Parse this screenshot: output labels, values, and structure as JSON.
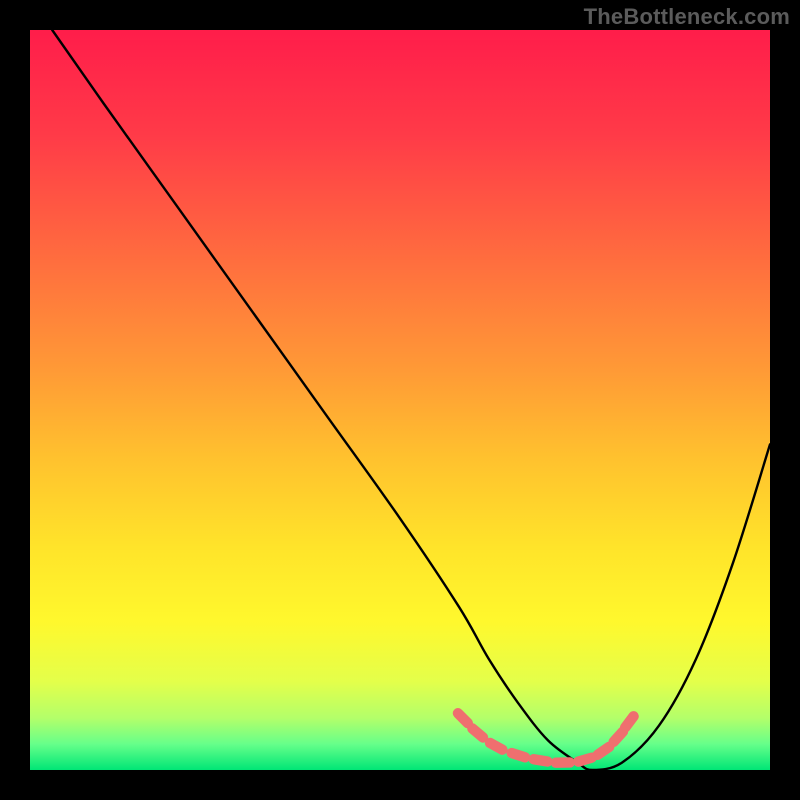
{
  "watermark": "TheBottleneck.com",
  "colors": {
    "gradient_stops": [
      {
        "offset": 0.0,
        "color": "#ff1d4a"
      },
      {
        "offset": 0.14,
        "color": "#ff3a48"
      },
      {
        "offset": 0.3,
        "color": "#ff6a3f"
      },
      {
        "offset": 0.46,
        "color": "#ff9a36"
      },
      {
        "offset": 0.58,
        "color": "#ffc22e"
      },
      {
        "offset": 0.7,
        "color": "#ffe42a"
      },
      {
        "offset": 0.8,
        "color": "#fff82d"
      },
      {
        "offset": 0.88,
        "color": "#e4ff4a"
      },
      {
        "offset": 0.93,
        "color": "#b3ff6a"
      },
      {
        "offset": 0.965,
        "color": "#66ff8a"
      },
      {
        "offset": 1.0,
        "color": "#00e676"
      }
    ],
    "curve": "#000000",
    "dash_dot": "#ef6f6f",
    "background": "#000000"
  },
  "chart_data": {
    "type": "line",
    "title": "",
    "xlabel": "",
    "ylabel": "",
    "xlim": [
      0,
      100
    ],
    "ylim": [
      0,
      100
    ],
    "grid": false,
    "series": [
      {
        "name": "bottleneck-curve",
        "x": [
          3,
          10,
          20,
          30,
          40,
          50,
          58,
          62,
          66,
          70,
          74,
          76,
          80,
          85,
          90,
          95,
          100
        ],
        "y": [
          100,
          90,
          76,
          62,
          48,
          34,
          22,
          15,
          9,
          4,
          1,
          0,
          1,
          6,
          15,
          28,
          44
        ]
      }
    ],
    "highlight_dots": [
      {
        "x": 58.5,
        "y": 7.0
      },
      {
        "x": 60.5,
        "y": 5.0
      },
      {
        "x": 63.0,
        "y": 3.2
      },
      {
        "x": 66.0,
        "y": 2.0
      },
      {
        "x": 69.0,
        "y": 1.3
      },
      {
        "x": 72.0,
        "y": 1.0
      },
      {
        "x": 75.0,
        "y": 1.4
      },
      {
        "x": 77.5,
        "y": 2.6
      },
      {
        "x": 79.5,
        "y": 4.5
      },
      {
        "x": 81.0,
        "y": 6.5
      }
    ]
  }
}
